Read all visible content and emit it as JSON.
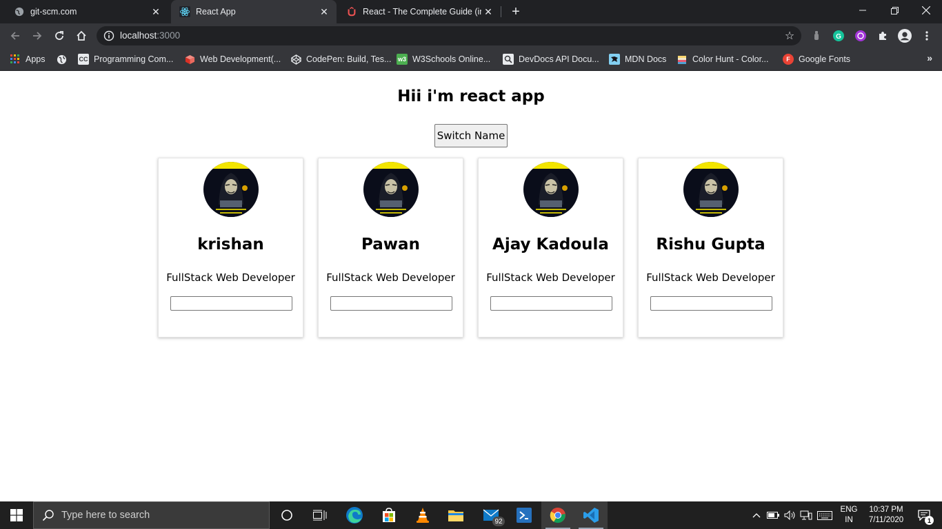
{
  "browser": {
    "tabs": [
      {
        "title": "git-scm.com",
        "active": false
      },
      {
        "title": "React App",
        "active": true
      },
      {
        "title": "React - The Complete Guide (incl",
        "active": false
      }
    ],
    "address": {
      "host": "localhost",
      "port": ":3000"
    },
    "bookmarks": [
      {
        "label": "Apps",
        "icon": "apps-grid-icon"
      },
      {
        "label": "",
        "icon": "globe-icon"
      },
      {
        "label": "Programming Com...",
        "icon": "cc-icon"
      },
      {
        "label": "Web Development(...",
        "icon": "cube-icon"
      },
      {
        "label": "CodePen: Build, Tes...",
        "icon": "codepen-icon"
      },
      {
        "label": "W3Schools Online...",
        "icon": "w3schools-icon"
      },
      {
        "label": "DevDocs API Docu...",
        "icon": "devdocs-icon"
      },
      {
        "label": "MDN Docs",
        "icon": "mdn-icon"
      },
      {
        "label": "Color Hunt - Color...",
        "icon": "colorhunt-icon"
      },
      {
        "label": "Google Fonts",
        "icon": "google-fonts-icon"
      }
    ]
  },
  "app": {
    "heading": "Hii i'm react app",
    "switch_button": "Switch Name",
    "people": [
      {
        "name": "krishan",
        "role": "FullStack Web Developer",
        "input_value": ""
      },
      {
        "name": "Pawan",
        "role": "FullStack Web Developer",
        "input_value": ""
      },
      {
        "name": "Ajay Kadoula",
        "role": "FullStack Web Developer",
        "input_value": ""
      },
      {
        "name": "Rishu Gupta",
        "role": "FullStack Web Developer",
        "input_value": ""
      }
    ]
  },
  "taskbar": {
    "search_placeholder": "Type here to search",
    "mail_badge": "92",
    "language": {
      "line1": "ENG",
      "line2": "IN"
    },
    "clock": {
      "time": "10:37 PM",
      "date": "7/11/2020"
    },
    "notification_count": "1"
  },
  "colors": {
    "tab_strip": "#202124",
    "toolbar": "#35363a",
    "taskbar": "#202020",
    "react_favicon": "#61dafb",
    "udemy_favicon": "#ec5252"
  }
}
